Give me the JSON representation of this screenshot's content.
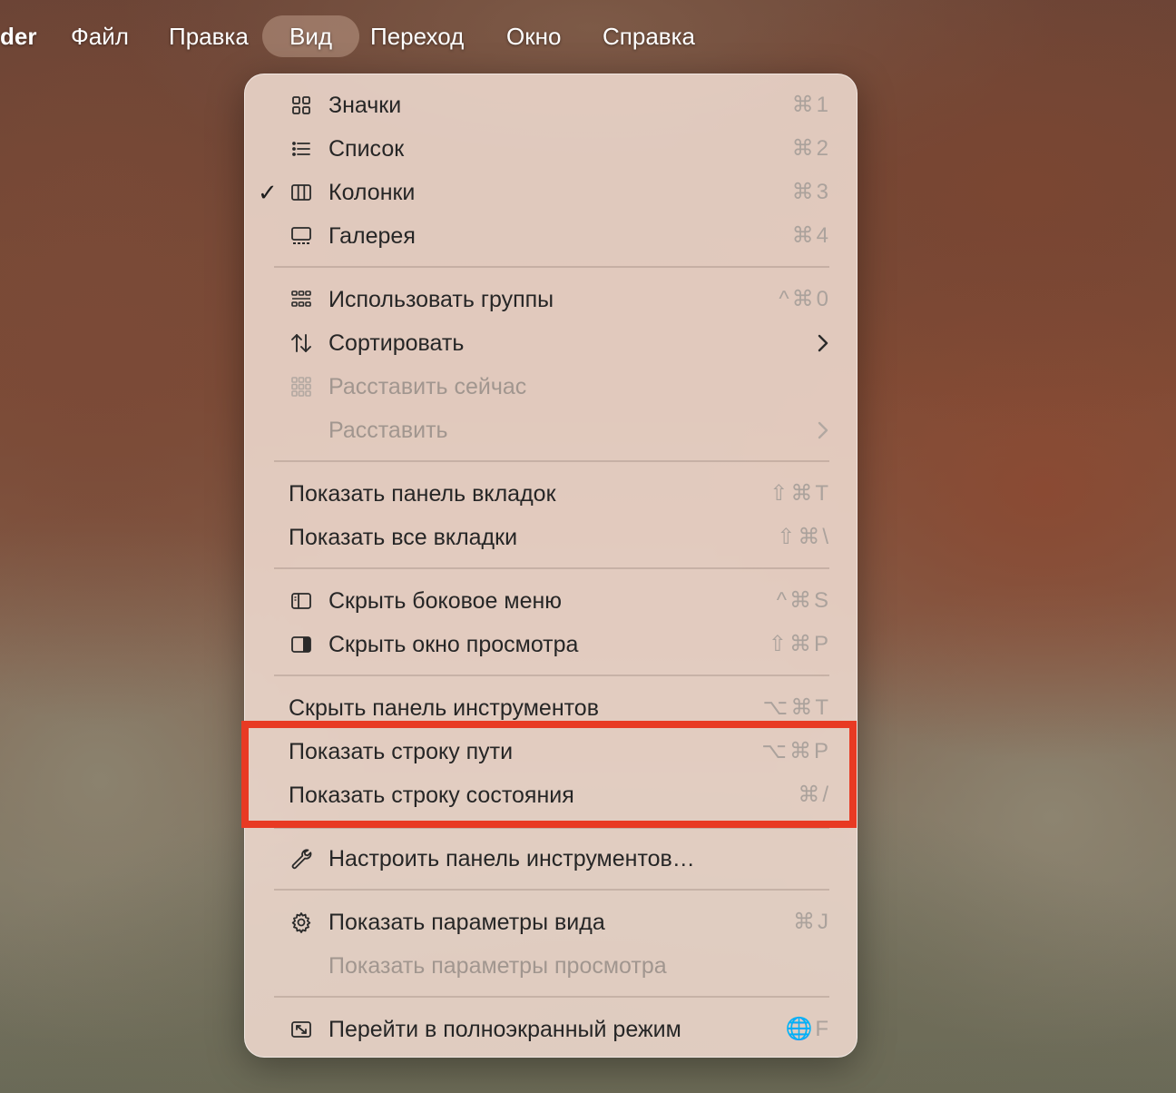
{
  "menubar": {
    "app": "der",
    "items": [
      "Файл",
      "Правка",
      "Вид",
      "Переход",
      "Окно",
      "Справка"
    ]
  },
  "colors": {
    "highlight": "#e83a23",
    "menu_background": "#ecd7cc"
  },
  "menu": {
    "items": [
      {
        "label": "Значки",
        "shortcut": "⌘1",
        "icon": "icons-view-icon"
      },
      {
        "label": "Список",
        "shortcut": "⌘2",
        "icon": "list-view-icon"
      },
      {
        "label": "Колонки",
        "shortcut": "⌘3",
        "icon": "columns-view-icon",
        "checked": true
      },
      {
        "label": "Галерея",
        "shortcut": "⌘4",
        "icon": "gallery-view-icon"
      },
      {
        "label": "Использовать группы",
        "shortcut": "^⌘0",
        "icon": "groups-icon"
      },
      {
        "label": "Сортировать",
        "shortcut": "",
        "icon": "sort-icon",
        "submenu": true
      },
      {
        "label": "Расставить сейчас",
        "shortcut": "",
        "icon": "arrange-grid-icon",
        "disabled": true
      },
      {
        "label": "Расставить",
        "shortcut": "",
        "disabled": true,
        "submenu": true
      },
      {
        "label": "Показать панель вкладок",
        "shortcut": "⇧⌘T"
      },
      {
        "label": "Показать все вкладки",
        "shortcut": "⇧⌘\\"
      },
      {
        "label": "Скрыть боковое меню",
        "shortcut": "^⌘S",
        "icon": "sidebar-icon"
      },
      {
        "label": "Скрыть окно просмотра",
        "shortcut": "⇧⌘P",
        "icon": "preview-pane-icon"
      },
      {
        "label": "Скрыть панель инструментов",
        "shortcut": "⌥⌘T"
      },
      {
        "label": "Показать строку пути",
        "shortcut": "⌥⌘P"
      },
      {
        "label": "Показать строку состояния",
        "shortcut": "⌘/"
      },
      {
        "label": "Настроить панель инструментов…",
        "shortcut": "",
        "icon": "wrench-icon"
      },
      {
        "label": "Показать параметры вида",
        "shortcut": "⌘J",
        "icon": "gear-icon"
      },
      {
        "label": "Показать параметры просмотра",
        "shortcut": "",
        "disabled": true
      },
      {
        "label": "Перейти в полноэкранный режим",
        "shortcut": "🌐F",
        "icon": "fullscreen-icon"
      }
    ]
  }
}
